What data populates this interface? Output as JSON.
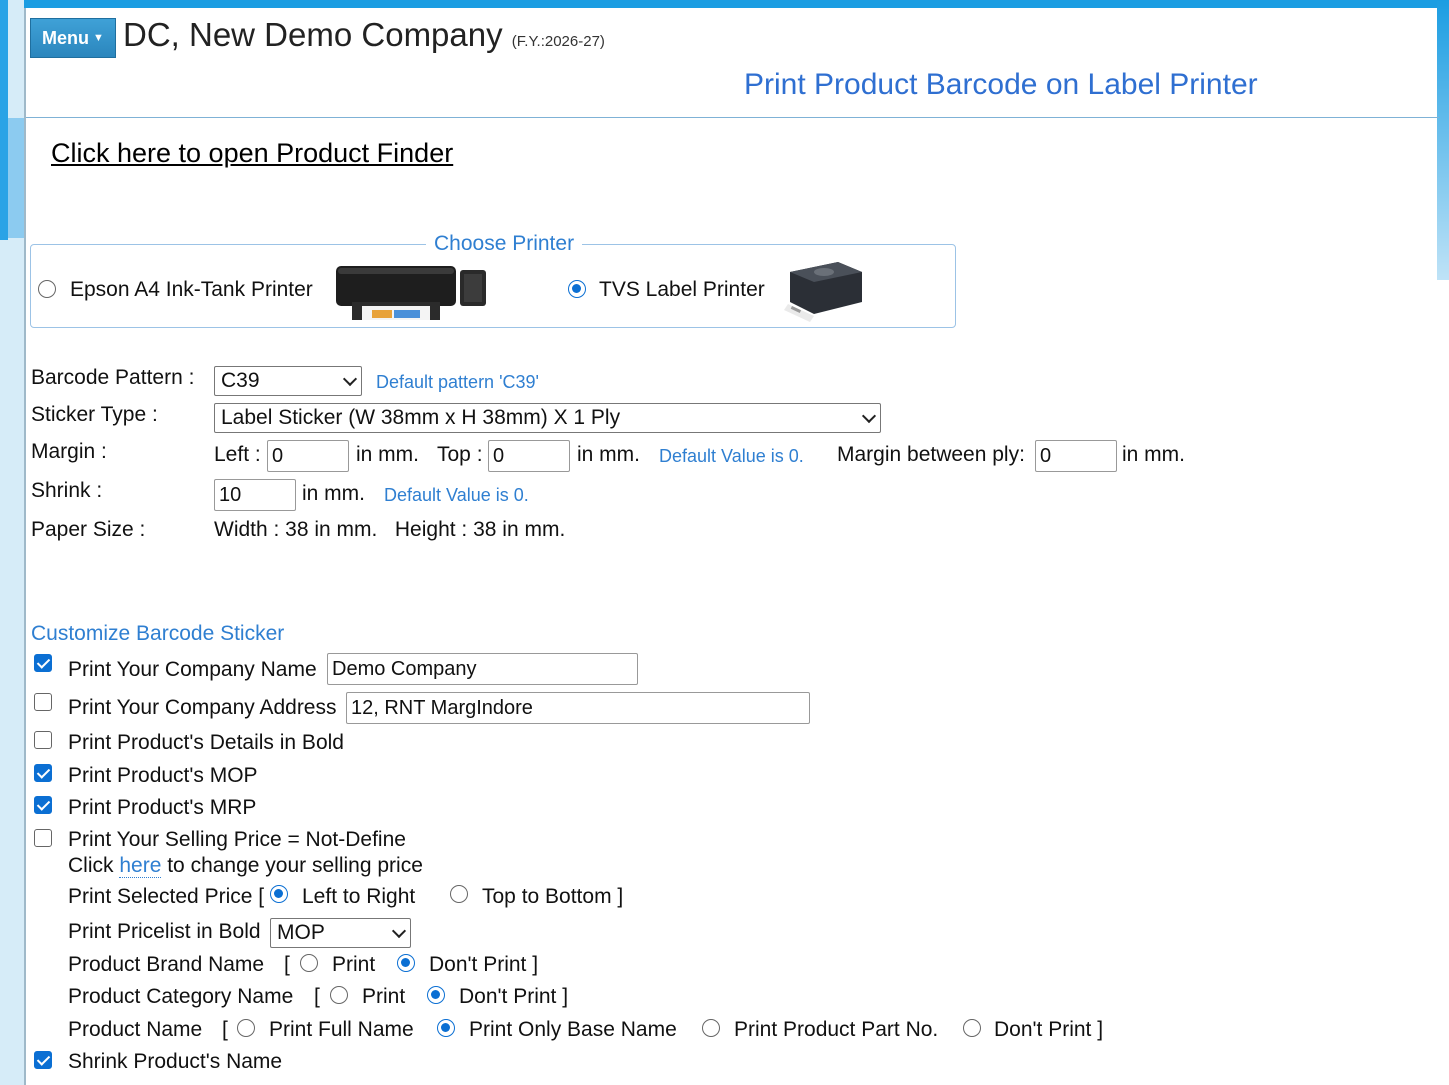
{
  "header": {
    "menu_label": "Menu",
    "company_name": "DC, New Demo Company",
    "fy": "(F.Y.:2026-27)",
    "page_title": "Print Product Barcode on Label Printer"
  },
  "finder_link": "Click here to open Product Finder",
  "printer": {
    "legend": "Choose Printer",
    "option1": "Epson A4 Ink-Tank Printer",
    "option2": "TVS Label Printer",
    "selected": "TVS Label Printer"
  },
  "settings": {
    "barcode_label": "Barcode Pattern :",
    "barcode_value": "C39",
    "barcode_hint": "Default pattern 'C39'",
    "sticker_label": "Sticker Type :",
    "sticker_value": "Label Sticker (W 38mm x H 38mm) X 1 Ply",
    "margin_label": "Margin :",
    "left_label": "Left :",
    "left_value": "0",
    "in_mm": "in mm.",
    "top_label": "Top :",
    "top_value": "0",
    "default_hint": "Default Value is 0.",
    "ply_label": "Margin between ply:",
    "ply_value": "0",
    "in_mm_end": "in mm.",
    "shrink_label": "Shrink :",
    "shrink_value": "10",
    "paper_label": "Paper Size :",
    "paper_value": "Width : 38 in mm.   Height : 38 in mm."
  },
  "customize": {
    "title": "Customize Barcode Sticker",
    "company_name_label": "Print Your Company Name",
    "company_name_value": "Demo Company",
    "company_address_label": "Print Your Company Address",
    "company_address_value": "12, RNT MargIndore",
    "bold_label": "Print Product's Details in Bold",
    "mop_label": "Print Product's MOP",
    "mrp_label": "Print Product's MRP",
    "selling_price_label": "Print Your Selling Price = Not-Define",
    "click_text": "Click",
    "here_link": "here",
    "change_text": "to change your selling price",
    "selected_price_label": "Print Selected Price [",
    "left_to_right": "Left to Right",
    "top_to_bottom": "Top to Bottom ]",
    "pricelist_label": "Print Pricelist in Bold",
    "pricelist_value": "MOP",
    "brand_label": "Product Brand Name",
    "category_label": "Product Category Name",
    "bracket_open": "[",
    "print": "Print",
    "dont_print": "Don't Print ]",
    "product_name_label": "Product Name",
    "full_name": "Print Full Name",
    "base_name": "Print Only Base Name",
    "part_no": "Print Product Part No.",
    "shrink_name_label": "Shrink Product's Name"
  }
}
